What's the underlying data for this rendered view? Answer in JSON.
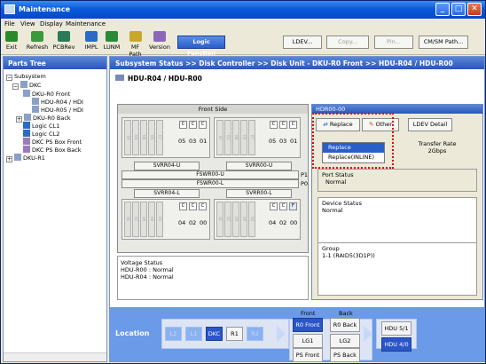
{
  "window": {
    "title": "Maintenance",
    "controls": [
      "_",
      "□",
      "✕"
    ]
  },
  "menu": [
    "File",
    "View",
    "Display",
    "Maintenance"
  ],
  "toolbar": {
    "buttons": [
      {
        "label": "Exit",
        "color": "#2a8a2a"
      },
      {
        "label": "Refresh",
        "color": "#3a9a3a"
      },
      {
        "label": "PCBRev",
        "color": "#2a7a5a"
      },
      {
        "label": "IMPL",
        "color": "#2a6ac8"
      },
      {
        "label": "LUNM",
        "color": "#2a8a3a"
      },
      {
        "label": "MF Path",
        "color": "#c8a82a"
      },
      {
        "label": "Version",
        "color": "#8a6ab8"
      }
    ],
    "logic_function": "Logic Function",
    "ldev": "LDEV...",
    "copy": "Copy...",
    "pin": "Pin...",
    "cmsm": "CM/SM Path..."
  },
  "tree": {
    "header": "Parts Tree",
    "items": [
      "Subsystem",
      "DKC",
      "DKU-R0 Front",
      "HDU-R04 / HDI",
      "HDU-R05 / HDI",
      "DKU-R0 Back",
      "Logic CL1",
      "Logic CL2",
      "DKC PS Box Front",
      "DKC PS Box Back",
      "DKU-R1"
    ],
    "expanders": [
      "−",
      "−",
      "+",
      "+"
    ]
  },
  "main": {
    "breadcrumb": "Subsystem Status >> Disk Controller >> Disk Unit - DKU-R0 Front >> HDU-R04 / HDU-R00",
    "subtitle": "HDU-R04 / HDU-R00"
  },
  "panel": {
    "header": "Front Side",
    "upper_slots_left": [
      "0F",
      "0D",
      "0B",
      "09",
      "07"
    ],
    "upper_slots_right": [
      "0F",
      "0D",
      "0B",
      "09",
      "07"
    ],
    "lower_slots_left": [
      "0E",
      "0C",
      "0A",
      "08",
      "06"
    ],
    "lower_slots_right": [
      "0E",
      "0C",
      "0A",
      "08",
      "06"
    ],
    "switch": "C",
    "switch_on": "F",
    "upper_nums": [
      "05",
      "03",
      "01"
    ],
    "lower_nums": [
      "04",
      "02",
      "00"
    ],
    "bars": {
      "svr04u": "SVRR04-U",
      "svr00u": "SVRR00-U",
      "fsw_u": "FSWR00-U",
      "fsw_l": "FSWR00-L",
      "svr04l": "SVRR04-L",
      "svr00l": "SVRR00-L"
    },
    "p1": "P1",
    "p0": "P0"
  },
  "voltage": {
    "title": "Voltage Status",
    "rows": [
      "HDU-R00   : Normal",
      "HDU-R04   : Normal"
    ]
  },
  "detail": {
    "header": "HDR00-00",
    "replace": "Replace",
    "other": "Other",
    "ldev_detail": "LDEV Detail",
    "menu": [
      "Replace",
      "Replace(INLINE)"
    ],
    "transfer_rate_label": "Transfer Rate",
    "transfer_rate_value": "2Gbps",
    "port_status_label": "Port Status",
    "port_status_value": "Normal",
    "device_status_label": "Device Status",
    "device_status_value": "Normal",
    "group_label": "Group",
    "group_value": "1-1 (RAID5(3D1P))"
  },
  "location": {
    "label": "Location",
    "chain": [
      "L2",
      "L1",
      "DKC",
      "R1",
      "R2"
    ],
    "front_label": "Front",
    "back_label": "Back",
    "front": [
      "R0 Front",
      "LG1",
      "PS Front"
    ],
    "back": [
      "R0 Back",
      "LG2",
      "PS Back"
    ],
    "hdu": [
      "HDU 5/1",
      "HDU 4/0"
    ]
  }
}
